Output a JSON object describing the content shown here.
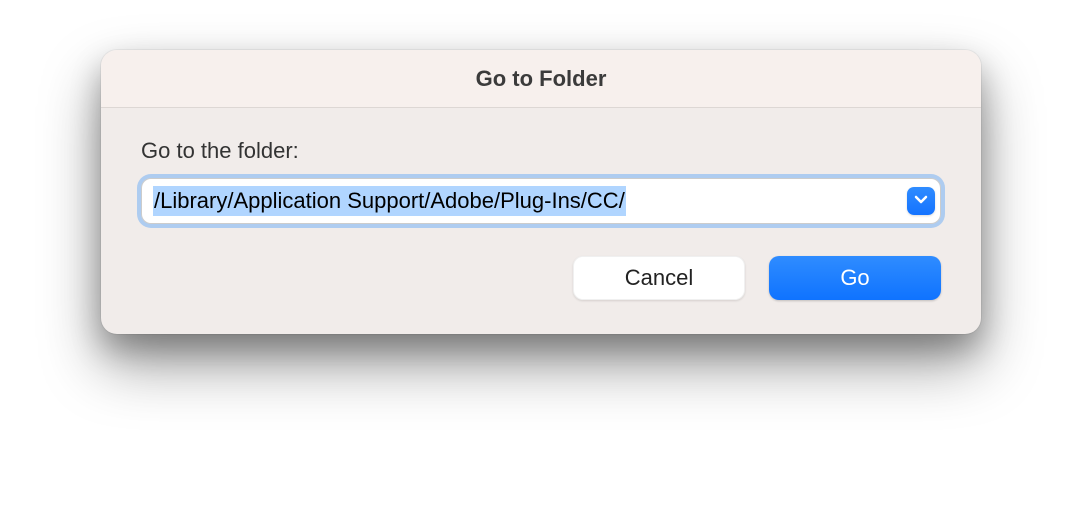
{
  "dialog": {
    "title": "Go to Folder",
    "label": "Go to the folder:",
    "path_value": "/Library/Application Support/Adobe/Plug-Ins/CC/",
    "buttons": {
      "cancel": "Cancel",
      "go": "Go"
    }
  }
}
